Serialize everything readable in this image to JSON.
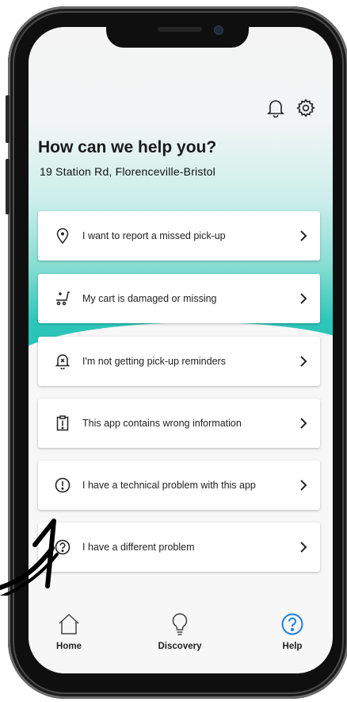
{
  "header": {
    "title": "How can we help you?",
    "address": "19 Station Rd, Florenceville-Bristol"
  },
  "icons": {
    "notifications": "bell-icon",
    "settings": "gear-icon"
  },
  "options": [
    {
      "label": "I want to report a missed pick-up",
      "icon": "location-pin-icon"
    },
    {
      "label": "My cart is damaged or missing",
      "icon": "cart-icon"
    },
    {
      "label": "I'm not getting pick-up reminders",
      "icon": "bell-off-icon"
    },
    {
      "label": "This app contains wrong information",
      "icon": "clipboard-alert-icon"
    },
    {
      "label": "I have a technical problem with this app",
      "icon": "exclamation-circle-icon"
    },
    {
      "label": "I have a different problem",
      "icon": "question-circle-icon"
    }
  ],
  "tabbar": {
    "home": "Home",
    "discovery": "Discovery",
    "help": "Help",
    "active": "help"
  },
  "colors": {
    "accent": "#1a7fe0",
    "teal": "#27c1b5"
  }
}
